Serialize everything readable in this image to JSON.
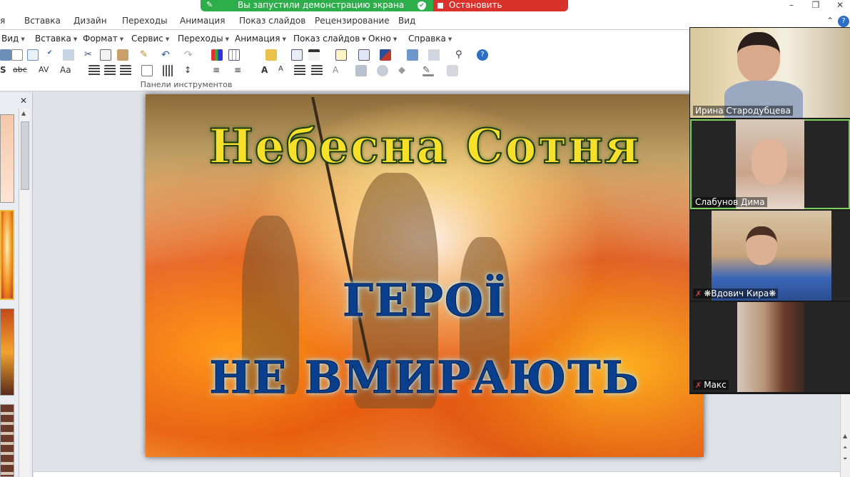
{
  "ribbon": {
    "tabs": [
      "я",
      "Вставка",
      "Дизайн",
      "Переходы",
      "Анимация",
      "Показ слайдов",
      "Рецензирование",
      "Вид"
    ],
    "window_min": "–",
    "window_restore": "❐",
    "window_close": "✕",
    "collapse": "⌃",
    "help": "?"
  },
  "share_banner": {
    "status_text": "Вы запустили демонстрацию экрана",
    "stop_label": "Остановить демонстрацию",
    "accent_green": "#2dae4a",
    "accent_red": "#d9322b"
  },
  "menubar": {
    "items": [
      "Вид",
      "Вставка",
      "Формат",
      "Сервис",
      "Переходы",
      "Анимация",
      "Показ слайдов",
      "Окно",
      "Справка"
    ]
  },
  "toolbars": {
    "caption": "Панели инструментов",
    "abc_label": "abc",
    "aa_label": "Aa"
  },
  "thumbs_pane": {
    "close_label": "✕"
  },
  "slide": {
    "title_line1": "Небесна  Сотня",
    "title_line2": "ГЕРОЇ",
    "title_line3": "НЕ  ВМИРАЮТЬ"
  },
  "participants": [
    {
      "name": "Ирина Стародубцева",
      "muted": false,
      "active": false
    },
    {
      "name": "Слабунов Дима",
      "muted": false,
      "active": true
    },
    {
      "name": "❋Вдович Кира❋",
      "muted": true,
      "active": false
    },
    {
      "name": "Макс",
      "muted": true,
      "active": false
    }
  ]
}
